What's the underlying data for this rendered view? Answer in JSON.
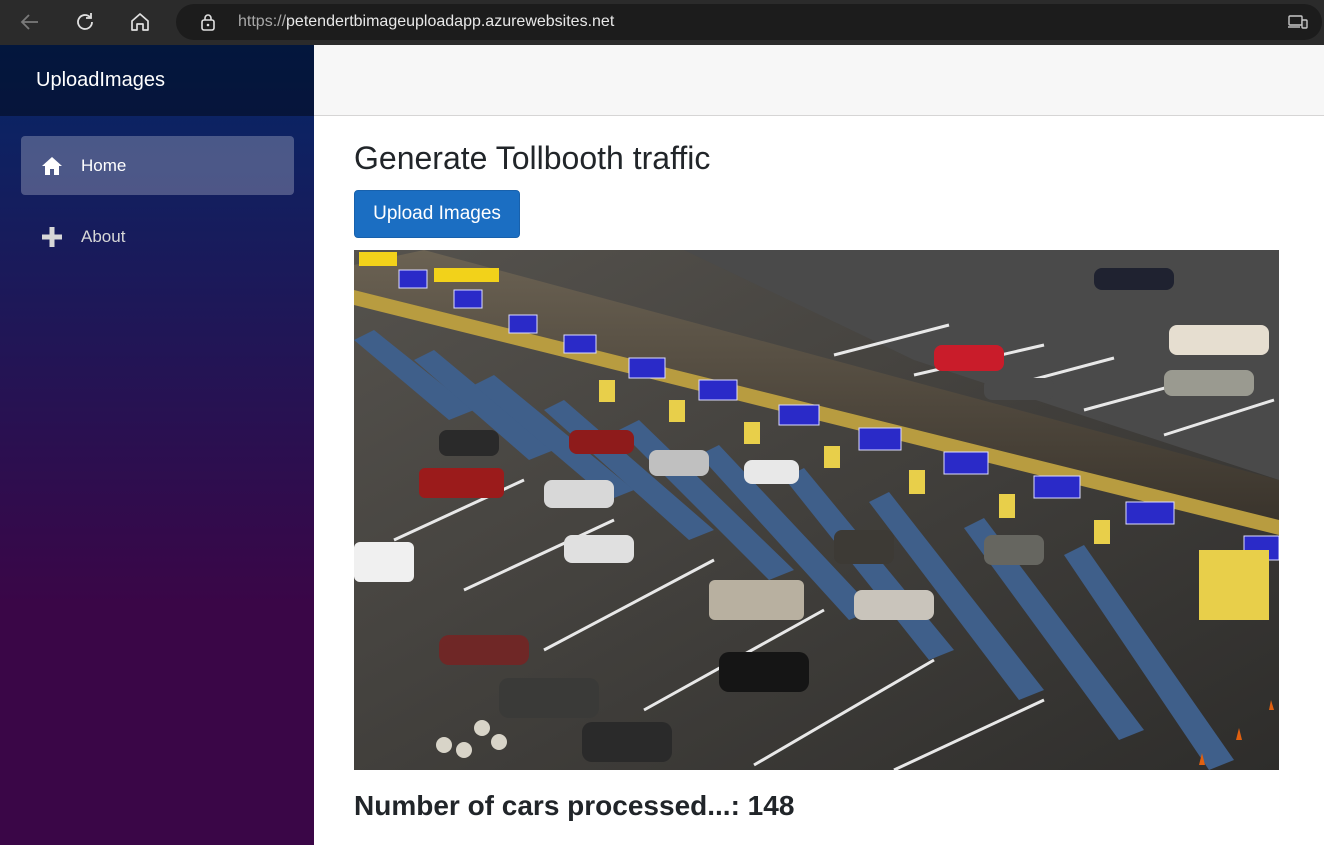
{
  "browser": {
    "url_scheme": "https://",
    "url_host": "petendertbimageuploadapp.azurewebsites.net"
  },
  "sidebar": {
    "brand": "UploadImages",
    "items": [
      {
        "label": "Home",
        "icon": "home-icon",
        "active": true
      },
      {
        "label": "About",
        "icon": "plus-icon",
        "active": false
      }
    ]
  },
  "main": {
    "title": "Generate Tollbooth traffic",
    "upload_button": "Upload Images",
    "count_label": "Number of cars processed...: 148"
  },
  "colors": {
    "primary_button": "#1b6ec2",
    "sidebar_top": "#052767",
    "sidebar_bottom": "#3a0647"
  }
}
